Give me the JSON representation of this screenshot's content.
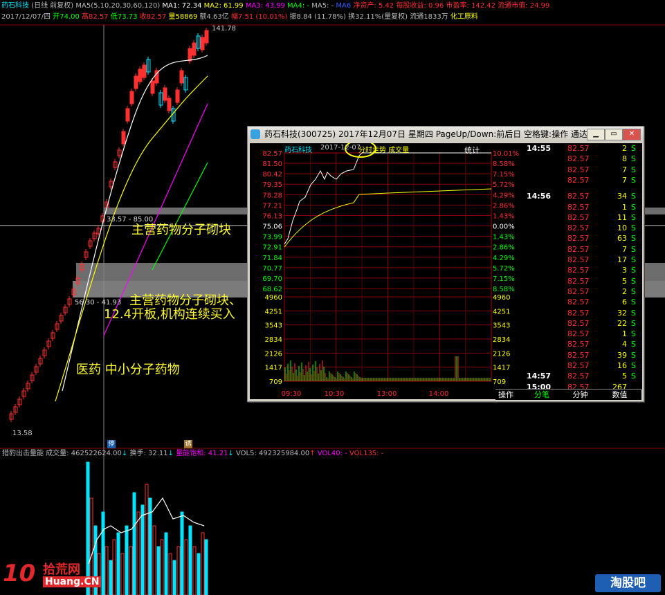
{
  "header": {
    "row1": {
      "stock_name": "药石科技",
      "period": "(日线 前复权)",
      "ma_params": "MA5(5,10,20,30,60,120)",
      "ma1": "MA1: 72.34",
      "ma2": "MA2: 61.99",
      "ma3": "MA3: 43.99",
      "ma4": "MA4: -",
      "ma5": "MA5: -",
      "ma6": "MA6",
      "net_assets": "净资产: 5.42",
      "eps": "每股收益: 0.96",
      "pe": "市盈率: 142.42",
      "float_mv": "流通市值: 24.99"
    },
    "row2": {
      "date": "2017/12/07/四",
      "open": "开74.00",
      "high": "高82.57",
      "low": "低73.73",
      "close": "收82.57",
      "volume": "量58869",
      "amount": "额4.63亿",
      "change": "幅7.51 (10.01%)",
      "amplitude": "振8.84 (11.78%)",
      "turnover": "换32.11%(量复权)",
      "float_shares": "流通1833万",
      "industry": "化工原料"
    }
  },
  "main_chart": {
    "high_label": "141.78",
    "low_label": "13.58",
    "range_label_1": "33.57 - 85.00",
    "range_label_2": "56.30 - 41.93",
    "annotations": {
      "a1": "主营药物分子砌块",
      "a2": "主营药物分子砌块、",
      "a3": "12.4开板,机构连续买入",
      "a4": "医药  中小分子药物"
    },
    "marker_ting": "停",
    "marker_hui": "诱"
  },
  "volume_indicator": {
    "name": "猎豹出击量能",
    "volume": "成交量: 462522624.00",
    "turnover": "换手: 32.11",
    "ratio": "量能饱和: 41.21",
    "vol5": "VOL5: 492325984.00",
    "vol40": "VOL40: -",
    "vol135": "VOL135: -"
  },
  "popup": {
    "title": "药石科技(300725) 2017年12月07日 星期四 PageUp/Down:前后日 空格键:操作 通达信(R)",
    "chart_header_name": "药石科技",
    "chart_header_date": "2017-12-07",
    "chart_header_label": "分时走势 成交量",
    "stats_label": "统计",
    "left_prices": [
      "82.57",
      "81.50",
      "80.42",
      "79.35",
      "78.28",
      "77.21",
      "76.13",
      "75.06",
      "73.99",
      "72.91",
      "71.84",
      "70.77",
      "69.70",
      "68.62"
    ],
    "right_pcts": [
      "10.01%",
      "8.58%",
      "7.15%",
      "5.72%",
      "4.29%",
      "2.86%",
      "1.43%",
      "0.00%",
      "1.43%",
      "2.86%",
      "4.29%",
      "5.72%",
      "7.15%",
      "8.58%"
    ],
    "vol_labels": [
      "4960",
      "4251",
      "3543",
      "2834",
      "2126",
      "1417",
      "709"
    ],
    "time_labels": [
      "09:30",
      "10:30",
      "13:00",
      "14:00"
    ],
    "ticks": [
      {
        "time": "14:55",
        "price": "82.57",
        "vol": "2",
        "side": "S"
      },
      {
        "time": "",
        "price": "82.57",
        "vol": "8",
        "side": "S"
      },
      {
        "time": "",
        "price": "82.57",
        "vol": "7",
        "side": "S"
      },
      {
        "time": "",
        "price": "82.57",
        "vol": "7",
        "side": "S"
      },
      {
        "time": "14:56",
        "price": "82.57",
        "vol": "34",
        "side": "S"
      },
      {
        "time": "",
        "price": "82.57",
        "vol": "1",
        "side": "S"
      },
      {
        "time": "",
        "price": "82.57",
        "vol": "11",
        "side": "S"
      },
      {
        "time": "",
        "price": "82.57",
        "vol": "10",
        "side": "S"
      },
      {
        "time": "",
        "price": "82.57",
        "vol": "63",
        "side": "S"
      },
      {
        "time": "",
        "price": "82.57",
        "vol": "7",
        "side": "S"
      },
      {
        "time": "",
        "price": "82.57",
        "vol": "17",
        "side": "S"
      },
      {
        "time": "",
        "price": "82.57",
        "vol": "3",
        "side": "S"
      },
      {
        "time": "",
        "price": "82.57",
        "vol": "5",
        "side": "S"
      },
      {
        "time": "",
        "price": "82.57",
        "vol": "2",
        "side": "S"
      },
      {
        "time": "",
        "price": "82.57",
        "vol": "6",
        "side": "S"
      },
      {
        "time": "",
        "price": "82.57",
        "vol": "32",
        "side": "S"
      },
      {
        "time": "",
        "price": "82.57",
        "vol": "22",
        "side": "S"
      },
      {
        "time": "",
        "price": "82.57",
        "vol": "1",
        "side": "S"
      },
      {
        "time": "",
        "price": "82.57",
        "vol": "4",
        "side": "S"
      },
      {
        "time": "",
        "price": "82.57",
        "vol": "39",
        "side": "S"
      },
      {
        "time": "",
        "price": "82.57",
        "vol": "16",
        "side": "S"
      },
      {
        "time": "14:57",
        "price": "82.57",
        "vol": "5",
        "side": "S"
      },
      {
        "time": "15:00",
        "price": "82.57",
        "vol": "267",
        "side": ""
      }
    ],
    "tabs": {
      "op": "操作",
      "fenbi": "分笔",
      "fenzhong": "分钟",
      "shuzhi": "数值"
    }
  },
  "watermarks": {
    "left_brand": "拾荒网",
    "left_url": "Huang.CN",
    "left_num": "10",
    "right_brand": "淘股吧"
  },
  "colors": {
    "up": "#ff3030",
    "down": "#00e5ff",
    "ma_white": "#ffffff",
    "ma_yellow": "#ffff00",
    "ma_magenta": "#ff00ff",
    "ma_green": "#00ff00"
  }
}
